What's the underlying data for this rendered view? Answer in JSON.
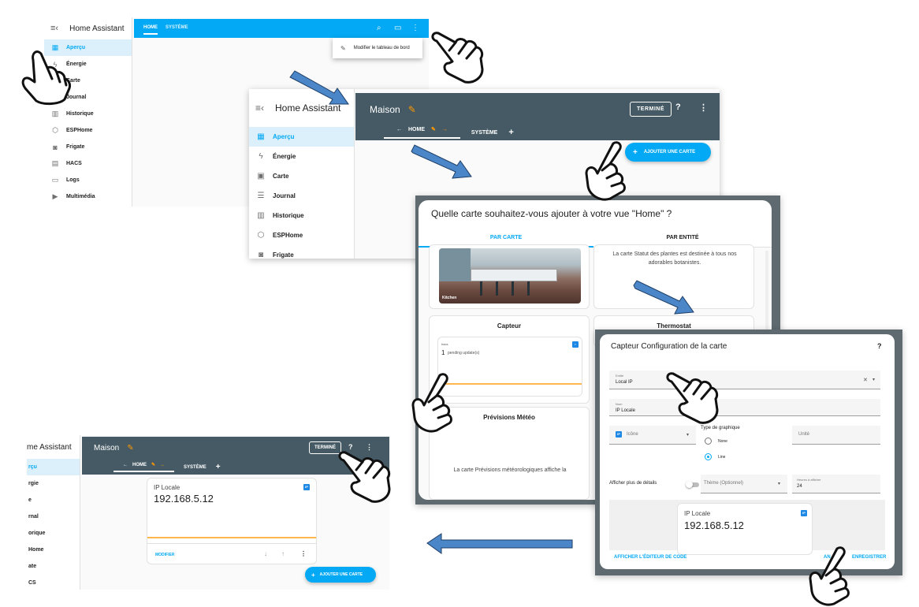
{
  "panel_a": {
    "app_title": "Home Assistant",
    "tabs": [
      "HOME",
      "SYSTÈME"
    ],
    "menu_item": "Modifier le tableau de bord",
    "sidebar": [
      {
        "label": "Aperçu",
        "icon": "dashboard-icon",
        "active": true
      },
      {
        "label": "Énergie",
        "icon": "lightning-icon"
      },
      {
        "label": "Carte",
        "icon": "map-icon"
      },
      {
        "label": "Journal",
        "icon": "list-icon"
      },
      {
        "label": "Historique",
        "icon": "chart-icon"
      },
      {
        "label": "ESPHome",
        "icon": "esp-icon"
      },
      {
        "label": "Frigate",
        "icon": "camera-icon"
      },
      {
        "label": "HACS",
        "icon": "hacs-icon"
      },
      {
        "label": "Logs",
        "icon": "logs-icon"
      },
      {
        "label": "Multimédia",
        "icon": "media-icon"
      }
    ]
  },
  "panel_b": {
    "app_title": "Home Assistant",
    "dashboard_title": "Maison",
    "done_label": "TERMINÉ",
    "tabs": [
      "HOME",
      "SYSTÈME"
    ],
    "add_card_label": "AJOUTER UNE CARTE",
    "sidebar": [
      {
        "label": "Aperçu",
        "active": true
      },
      {
        "label": "Énergie"
      },
      {
        "label": "Carte"
      },
      {
        "label": "Journal"
      },
      {
        "label": "Historique"
      },
      {
        "label": "ESPHome"
      },
      {
        "label": "Frigate"
      }
    ]
  },
  "panel_c": {
    "dialog_title": "Quelle carte souhaitez-vous ajouter à votre vue \"Home\" ?",
    "tab_by_card": "PAR CARTE",
    "tab_by_entity": "PAR ENTITÉ",
    "kitchen_label": "Kitchen",
    "plant_text": "La carte Statut des plantes est destinée à tous nos adorables botanistes.",
    "sensor_title": "Capteur",
    "sensor_name": "hacs",
    "sensor_value": "1",
    "sensor_unit": "pending update(s)",
    "thermostat_title": "Thermostat",
    "weather_title": "Prévisions Météo",
    "weather_text": "La carte Prévisions météorologiques affiche la"
  },
  "panel_d": {
    "dialog_title": "Capteur Configuration de la carte",
    "entity_label": "Entité",
    "entity_value": "Local IP",
    "name_label": "Nom",
    "name_value": "IP Locale",
    "icon_label": "Icône",
    "graph_type_label": "Type de graphique",
    "graph_none": "None",
    "graph_line": "Line",
    "unit_label": "Unité",
    "more_details_label": "Afficher plus de détails",
    "theme_label": "Thème (Optionnel)",
    "hours_label": "Heures à afficher",
    "hours_value": "24",
    "preview_label": "IP Locale",
    "preview_value": "192.168.5.12",
    "code_editor_label": "AFFICHER L'ÉDITEUR DE CODE",
    "cancel_label": "AN",
    "save_label": "ENREGISTRER"
  },
  "panel_e": {
    "app_title": "me Assistant",
    "dashboard_title": "Maison",
    "done_label": "TERMINÉ",
    "tabs": [
      "HOME",
      "SYSTÈME"
    ],
    "card_label": "IP Locale",
    "card_value": "192.168.5.12",
    "edit_label": "MODIFIER",
    "add_card_label": "AJOUTER UNE CARTE",
    "sidebar": [
      "rçu",
      "rgie",
      "e",
      "rnal",
      "orique",
      "Home",
      "ate",
      "CS"
    ]
  },
  "colors": {
    "accent": "#03a9f4",
    "header_dark": "#455a64",
    "pencil": "#ff9800",
    "arrow_fill": "#4a86c8"
  }
}
